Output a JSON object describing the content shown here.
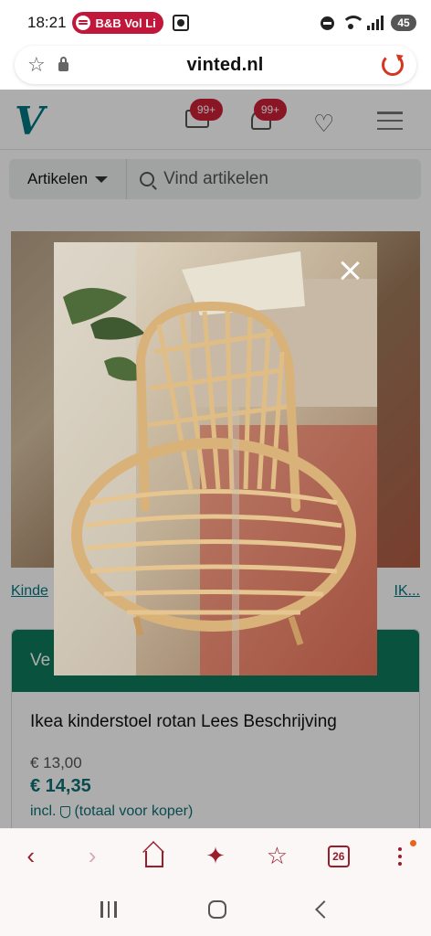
{
  "status_bar": {
    "time": "18:21",
    "media_label": "B&B Vol Li",
    "battery": "45"
  },
  "browser": {
    "url": "vinted.nl"
  },
  "header": {
    "inbox_badge": "99+",
    "notifications_badge": "99+"
  },
  "search": {
    "category_label": "Artikelen",
    "placeholder": "Vind artikelen"
  },
  "breadcrumb": {
    "left": "Kinde",
    "right": "IK..."
  },
  "product": {
    "buy_label": "Ve",
    "title": "Ikea kinderstoel rotan Lees Beschrijving",
    "price_old": "€ 13,00",
    "price_new": "€ 14,35",
    "incl_label": "incl.",
    "incl_suffix": "(totaal voor koper)"
  },
  "browser_nav": {
    "tabs_count": "26"
  },
  "colors": {
    "brand": "#007782",
    "badge": "#cc1f36",
    "buy_button": "#0e7a5b",
    "browser_accent": "#9b1c2a"
  }
}
